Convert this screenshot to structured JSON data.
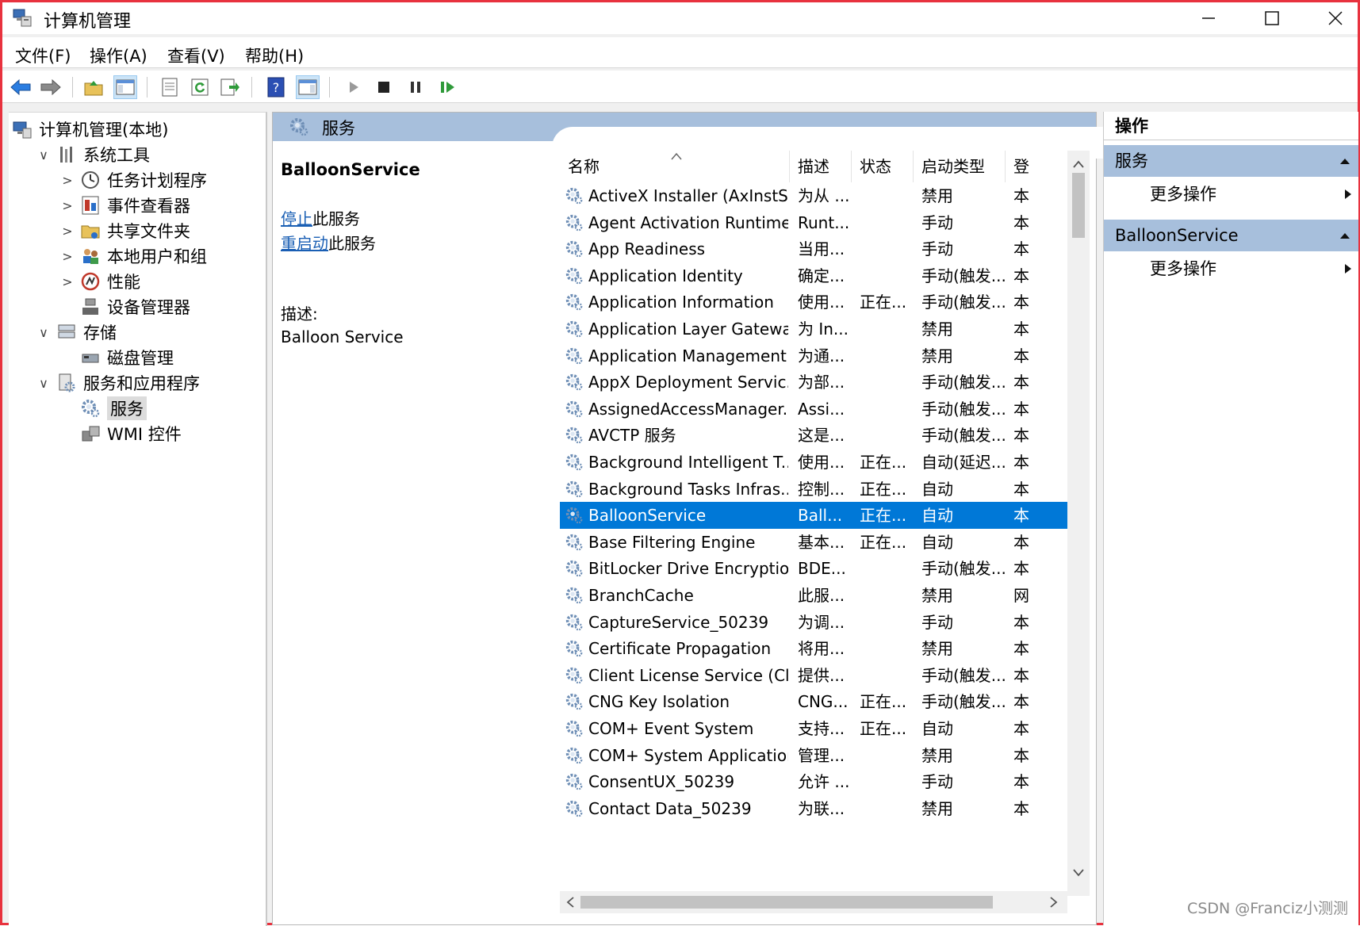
{
  "window": {
    "title": "计算机管理",
    "minimize": "—",
    "maximize": "☐",
    "close": "✕"
  },
  "menu": [
    "文件(F)",
    "操作(A)",
    "查看(V)",
    "帮助(H)"
  ],
  "tree": [
    {
      "label": "计算机管理(本地)",
      "level": 0,
      "chev": "",
      "icon": "computer-icon"
    },
    {
      "label": "系统工具",
      "level": 1,
      "chev": "∨",
      "icon": "tools-icon"
    },
    {
      "label": "任务计划程序",
      "level": 2,
      "chev": ">",
      "icon": "clock-icon"
    },
    {
      "label": "事件查看器",
      "level": 2,
      "chev": ">",
      "icon": "event-viewer-icon"
    },
    {
      "label": "共享文件夹",
      "level": 2,
      "chev": ">",
      "icon": "shared-folder-icon"
    },
    {
      "label": "本地用户和组",
      "level": 2,
      "chev": ">",
      "icon": "users-icon"
    },
    {
      "label": "性能",
      "level": 2,
      "chev": ">",
      "icon": "performance-icon"
    },
    {
      "label": "设备管理器",
      "level": 2,
      "chev": "",
      "icon": "device-manager-icon"
    },
    {
      "label": "存储",
      "level": 1,
      "chev": "∨",
      "icon": "storage-icon"
    },
    {
      "label": "磁盘管理",
      "level": 2,
      "chev": "",
      "icon": "disk-icon"
    },
    {
      "label": "服务和应用程序",
      "level": 1,
      "chev": "∨",
      "icon": "services-apps-icon"
    },
    {
      "label": "服务",
      "level": 2,
      "chev": "",
      "icon": "gear-icon",
      "selected": true
    },
    {
      "label": "WMI 控件",
      "level": 2,
      "chev": "",
      "icon": "wmi-icon"
    }
  ],
  "center": {
    "header": "服务",
    "selected_service": "BalloonService",
    "stop_link": "停止",
    "stop_suffix": "此服务",
    "restart_link": "重启动",
    "restart_suffix": "此服务",
    "desc_label": "描述:",
    "desc_value": "Balloon Service"
  },
  "columns": [
    "名称",
    "描述",
    "状态",
    "启动类型",
    "登"
  ],
  "services": [
    {
      "name": "ActiveX Installer (AxInstSV)",
      "desc": "为从 ...",
      "status": "",
      "startup": "禁用",
      "logon": "本"
    },
    {
      "name": "Agent Activation Runtime...",
      "desc": "Runt...",
      "status": "",
      "startup": "手动",
      "logon": "本"
    },
    {
      "name": "App Readiness",
      "desc": "当用...",
      "status": "",
      "startup": "手动",
      "logon": "本"
    },
    {
      "name": "Application Identity",
      "desc": "确定...",
      "status": "",
      "startup": "手动(触发...",
      "logon": "本"
    },
    {
      "name": "Application Information",
      "desc": "使用...",
      "status": "正在...",
      "startup": "手动(触发...",
      "logon": "本"
    },
    {
      "name": "Application Layer Gatewa...",
      "desc": "为 In...",
      "status": "",
      "startup": "禁用",
      "logon": "本"
    },
    {
      "name": "Application Management",
      "desc": "为通...",
      "status": "",
      "startup": "禁用",
      "logon": "本"
    },
    {
      "name": "AppX Deployment Servic...",
      "desc": "为部...",
      "status": "",
      "startup": "手动(触发...",
      "logon": "本"
    },
    {
      "name": "AssignedAccessManager...",
      "desc": "Assi...",
      "status": "",
      "startup": "手动(触发...",
      "logon": "本"
    },
    {
      "name": "AVCTP 服务",
      "desc": "这是...",
      "status": "",
      "startup": "手动(触发...",
      "logon": "本"
    },
    {
      "name": "Background Intelligent T...",
      "desc": "使用...",
      "status": "正在...",
      "startup": "自动(延迟...",
      "logon": "本"
    },
    {
      "name": "Background Tasks Infras...",
      "desc": "控制...",
      "status": "正在...",
      "startup": "自动",
      "logon": "本"
    },
    {
      "name": "BalloonService",
      "desc": "Ball...",
      "status": "正在...",
      "startup": "自动",
      "logon": "本",
      "selected": true
    },
    {
      "name": "Base Filtering Engine",
      "desc": "基本...",
      "status": "正在...",
      "startup": "自动",
      "logon": "本"
    },
    {
      "name": "BitLocker Drive Encryptio...",
      "desc": "BDE...",
      "status": "",
      "startup": "手动(触发...",
      "logon": "本"
    },
    {
      "name": "BranchCache",
      "desc": "此服...",
      "status": "",
      "startup": "禁用",
      "logon": "网"
    },
    {
      "name": "CaptureService_50239",
      "desc": "为调...",
      "status": "",
      "startup": "手动",
      "logon": "本"
    },
    {
      "name": "Certificate Propagation",
      "desc": "将用...",
      "status": "",
      "startup": "禁用",
      "logon": "本"
    },
    {
      "name": "Client License Service (Cli...",
      "desc": "提供...",
      "status": "",
      "startup": "手动(触发...",
      "logon": "本"
    },
    {
      "name": "CNG Key Isolation",
      "desc": "CNG...",
      "status": "正在...",
      "startup": "手动(触发...",
      "logon": "本"
    },
    {
      "name": "COM+ Event System",
      "desc": "支持...",
      "status": "正在...",
      "startup": "自动",
      "logon": "本"
    },
    {
      "name": "COM+ System Application",
      "desc": "管理...",
      "status": "",
      "startup": "禁用",
      "logon": "本"
    },
    {
      "name": "ConsentUX_50239",
      "desc": "允许 ...",
      "status": "",
      "startup": "手动",
      "logon": "本"
    },
    {
      "name": "Contact Data_50239",
      "desc": "为联...",
      "status": "",
      "startup": "禁用",
      "logon": "本"
    }
  ],
  "actions": {
    "header": "操作",
    "sections": [
      {
        "title": "服务",
        "more": "更多操作"
      },
      {
        "title": "BalloonService",
        "more": "更多操作"
      }
    ]
  },
  "watermark": "CSDN @Franciz小测测",
  "colors": {
    "selection": "#0078d7",
    "pane_header": "#a7bfdc",
    "frame_border": "#e8323e",
    "link": "#1a5fb4"
  }
}
